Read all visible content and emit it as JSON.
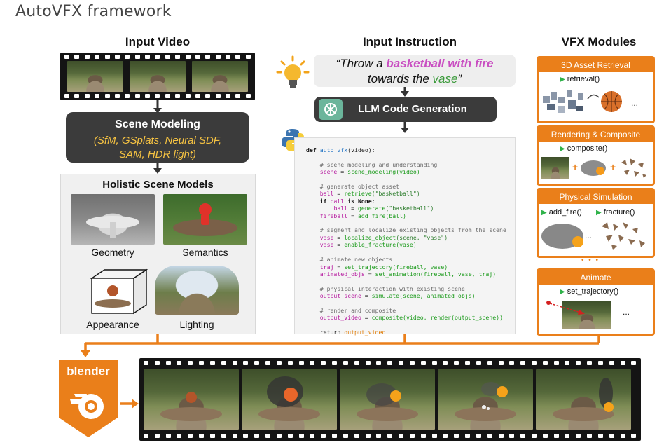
{
  "page_title": "AutoVFX framework",
  "sections": {
    "input_video": "Input Video",
    "input_instruction": "Input Instruction",
    "vfx_modules": "VFX Modules"
  },
  "scene_modeling": {
    "title": "Scene Modeling",
    "line1": "(SfM, GSplats, Neural SDF,",
    "line2": "SAM, HDR light)"
  },
  "holistic": {
    "title": "Holistic Scene Models",
    "labels": [
      "Geometry",
      "Semantics",
      "Appearance",
      "Lighting"
    ]
  },
  "instruction": {
    "pre": "“Throw a ",
    "highlight": "basketball with fire",
    "mid": "towards the ",
    "object": "vase",
    "post": "”"
  },
  "llm": {
    "label": "LLM Code Generation"
  },
  "code": {
    "def_kw": "def",
    "def_name": "auto_vfx",
    "def_args": "(video):",
    "l01": "# scene modeling and understanding",
    "l02a": "scene",
    "l02b": " = ",
    "l02c": "scene_modeling",
    "l02d": "(video)",
    "l03": "# generate object asset",
    "l04a": "ball",
    "l04b": " = ",
    "l04c": "retrieve",
    "l04d": "(\"basketball\")",
    "l05a": "if",
    "l05b": " ball ",
    "l05c": "is None",
    "l05d": ":",
    "l06a": "ball",
    "l06b": " = ",
    "l06c": "generate",
    "l06d": "(\"basketball\")",
    "l07a": "fireball",
    "l07b": " = ",
    "l07c": "add_fire",
    "l07d": "(ball)",
    "l08": "# segment and localize existing objects from the scene",
    "l09a": "vase",
    "l09b": " = ",
    "l09c": "localize_object",
    "l09d": "(scene, \"vase\")",
    "l10a": "vase",
    "l10b": " = ",
    "l10c": "enable_fracture",
    "l10d": "(vase)",
    "l11": "# animate new objects",
    "l12a": "traj",
    "l12b": " = ",
    "l12c": "set_trajectory",
    "l12d": "(fireball, vase)",
    "l13a": "animated_objs",
    "l13b": " = ",
    "l13c": "set_animation",
    "l13d": "(fireball, vase, traj)",
    "l14": "# physical interaction with existing scene",
    "l15a": "output_scene",
    "l15b": " = ",
    "l15c": "simulate",
    "l15d": "(scene, animated_objs)",
    "l16": "# render and composite",
    "l17a": "output_video",
    "l17b": " = ",
    "l17c": "composite",
    "l17d": "(video, ",
    "l17e": "render",
    "l17f": "(output_scene))",
    "l18a": "return",
    "l18b": " output_video"
  },
  "modules": {
    "asset": {
      "title": "3D Asset Retrieval",
      "fn": "retrieval()",
      "ellipsis": "..."
    },
    "render": {
      "title": "Rendering & Composite",
      "fn": "composite()",
      "plus1": "+",
      "plus2": "+"
    },
    "physics": {
      "title": "Physical Simulation",
      "fn1": "add_fire()",
      "fn2": "fracture()",
      "ellipsis": "..."
    },
    "dots": "• • •",
    "animate": {
      "title": "Animate",
      "fn": "set_trajectory()",
      "ellipsis": "..."
    }
  },
  "blender": {
    "label": "blender"
  },
  "colors": {
    "orange": "#ea7f1a",
    "dark_box": "#3b3b3b",
    "highlight_pink": "#c94fc2",
    "highlight_green": "#3a9a3a",
    "scene_modeling_yellow": "#f5c242",
    "play_green": "#2fb24a"
  }
}
